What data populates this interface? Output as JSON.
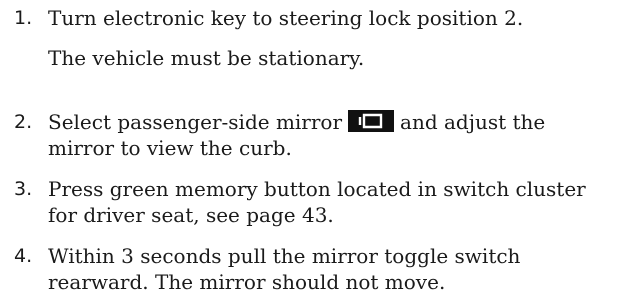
{
  "steps": [
    {
      "number": "1.",
      "lines": [
        "Turn electronic key to steering lock position 2."
      ],
      "note": "The vehicle must be stationary."
    },
    {
      "number": "2.",
      "line1_before_icon": "Select passenger-side mirror",
      "line1_after_icon": "and adjust the",
      "line2": "mirror to view the curb.",
      "icon": "passenger-side-mirror-icon"
    },
    {
      "number": "3.",
      "lines": [
        "Press green memory button located in switch cluster",
        "for driver seat, see page 43."
      ]
    },
    {
      "number": "4.",
      "lines": [
        "Within 3 seconds pull the mirror toggle switch",
        "rearward. The mirror should not move."
      ]
    }
  ],
  "colors": {
    "text": "#1a1a1a",
    "icon_bg": "#111111",
    "icon_fg": "#ffffff"
  }
}
